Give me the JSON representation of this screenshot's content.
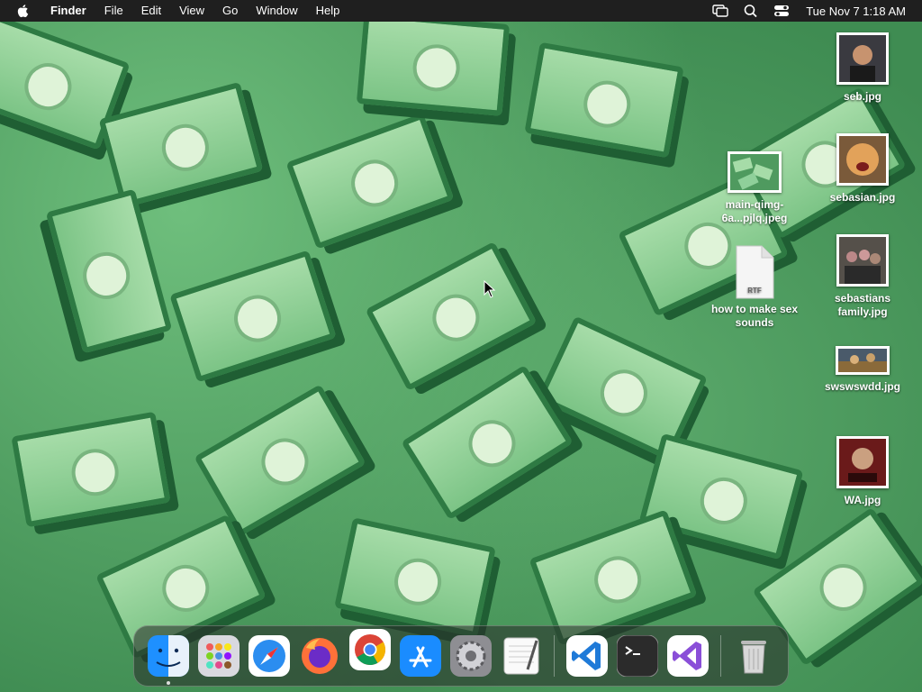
{
  "menubar": {
    "app_name": "Finder",
    "menus": [
      "File",
      "Edit",
      "View",
      "Go",
      "Window",
      "Help"
    ],
    "clock": "Tue Nov 7  1:18 AM"
  },
  "desktop": {
    "icons": [
      {
        "name": "seb.jpg"
      },
      {
        "name": "sebasian.jpg"
      },
      {
        "name": "main-qimg-6a...pjlq.jpeg"
      },
      {
        "name": "how to make sex sounds",
        "badge": "RTF"
      },
      {
        "name": "sebastians family.jpg"
      },
      {
        "name": "swswswdd.jpg"
      },
      {
        "name": "WA.jpg"
      }
    ]
  },
  "dock": {
    "apps": [
      "Finder",
      "Launchpad",
      "Safari",
      "Firefox",
      "Google Chrome",
      "App Store",
      "System Settings",
      "TextEdit",
      "Visual Studio Code",
      "Terminal",
      "Visual Studio",
      "Trash"
    ]
  },
  "colors": {
    "menubar": "#1f1f1f",
    "wallpaper": "#3f8c52"
  }
}
